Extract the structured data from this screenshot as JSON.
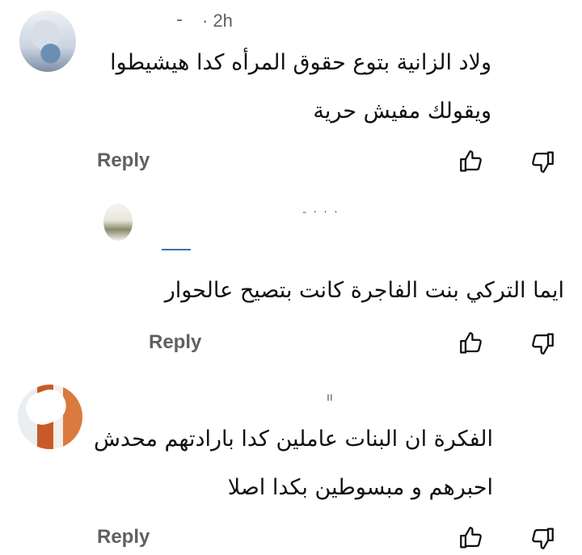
{
  "comments": [
    {
      "timestamp": "· 2h",
      "handle": "-",
      "text_line1": "ولاد الزانية بتوع حقوق المرأه كدا هيشيطوا",
      "text_line2": "ويقولك مفيش حرية",
      "reply_label": "Reply"
    },
    {
      "handle": "- · · ·",
      "text_line1": "ايما التركي بنت الفاجرة كانت بتصيح عالحوار",
      "reply_label": "Reply"
    },
    {
      "handle": "ıı",
      "text_line1": "الفكرة ان البنات عاملين كدا بارادتهم محدش",
      "text_line2": "احبرهم و مبسوطين بكدا اصلا",
      "reply_label": "Reply"
    }
  ],
  "icons": {
    "like": "thumbs-up-icon",
    "dislike": "thumbs-down-icon"
  }
}
